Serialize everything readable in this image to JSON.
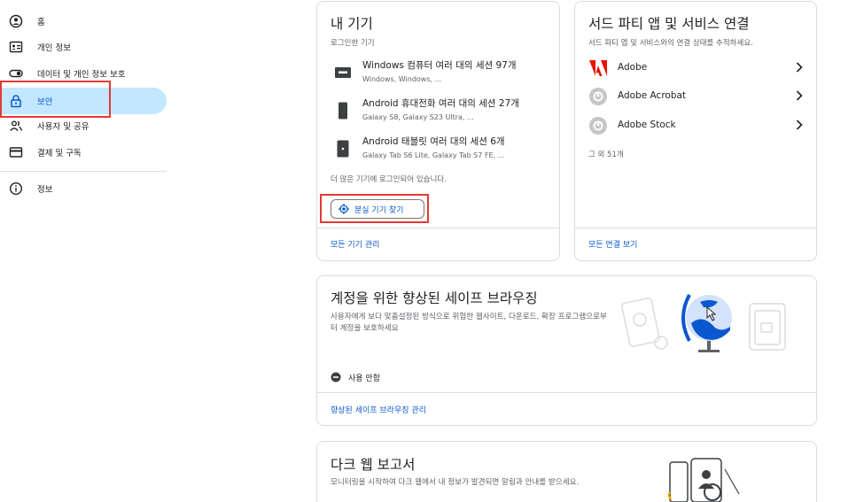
{
  "sidebar": {
    "items": [
      {
        "label": "홈",
        "icon": "account-circle-icon"
      },
      {
        "label": "개인 정보",
        "icon": "id-card-icon"
      },
      {
        "label": "데이터 및 개인 정보 보호",
        "icon": "toggle-icon"
      },
      {
        "label": "보안",
        "icon": "lock-icon"
      },
      {
        "label": "사용자 및 공유",
        "icon": "people-icon"
      },
      {
        "label": "결제 및 구독",
        "icon": "credit-card-icon"
      },
      {
        "label": "정보",
        "icon": "info-icon"
      }
    ],
    "active_index": 3
  },
  "devices_card": {
    "title": "내 기기",
    "subtitle": "로그인한 기기",
    "devices": [
      {
        "title": "Windows 컴퓨터 여러 대의 세션 97개",
        "sub": "Windows, Windows, ...",
        "icon": "computer-icon"
      },
      {
        "title": "Android 휴대전화 여러 대의 세션 27개",
        "sub": "Galaxy S8, Galaxy S23 Ultra, ...",
        "icon": "phone-icon"
      },
      {
        "title": "Android 태블릿 여러 대의 세션 6개",
        "sub": "Galaxy Tab S6 Lite, Galaxy Tab S7 FE, ...",
        "icon": "tablet-icon"
      }
    ],
    "more_text": "더 많은 기기에 로그인되어 있습니다.",
    "find_button": "분실 기기 찾기",
    "manage_link": "모든 기기 관리"
  },
  "third_party_card": {
    "title": "서드 파티 앱 및 서비스 연결",
    "subtitle": "서드 파티 앱 및 서비스와의 연결 상태를 추적하세요.",
    "apps": [
      {
        "label": "Adobe",
        "icon": "adobe-logo-icon"
      },
      {
        "label": "Adobe Acrobat",
        "icon": "acrobat-icon"
      },
      {
        "label": "Adobe Stock",
        "icon": "stock-icon"
      }
    ],
    "more_text": "그 외 51개",
    "view_link": "모든 연결 보기"
  },
  "safe_browsing_card": {
    "title": "계정을 위한 향상된 세이프 브라우징",
    "description": "사용자에게 보다 맞춤설정된 방식으로 위험한 웹사이트, 다운로드, 확장 프로그램으로부터 계정을 보호하세요",
    "status": "사용 안함",
    "manage_link": "향상된 세이프 브라우징 관리"
  },
  "dark_web_card": {
    "title": "다크 웹 보고서",
    "description": "모니터링을 시작하여 다크 웹에서 내 정보가 발견되면 알림과 안내를 받으세요."
  },
  "colors": {
    "accent": "#0b57d0",
    "active_bg": "#c2e7ff",
    "highlight": "#e53935",
    "adobe_red": "#eb1000"
  }
}
